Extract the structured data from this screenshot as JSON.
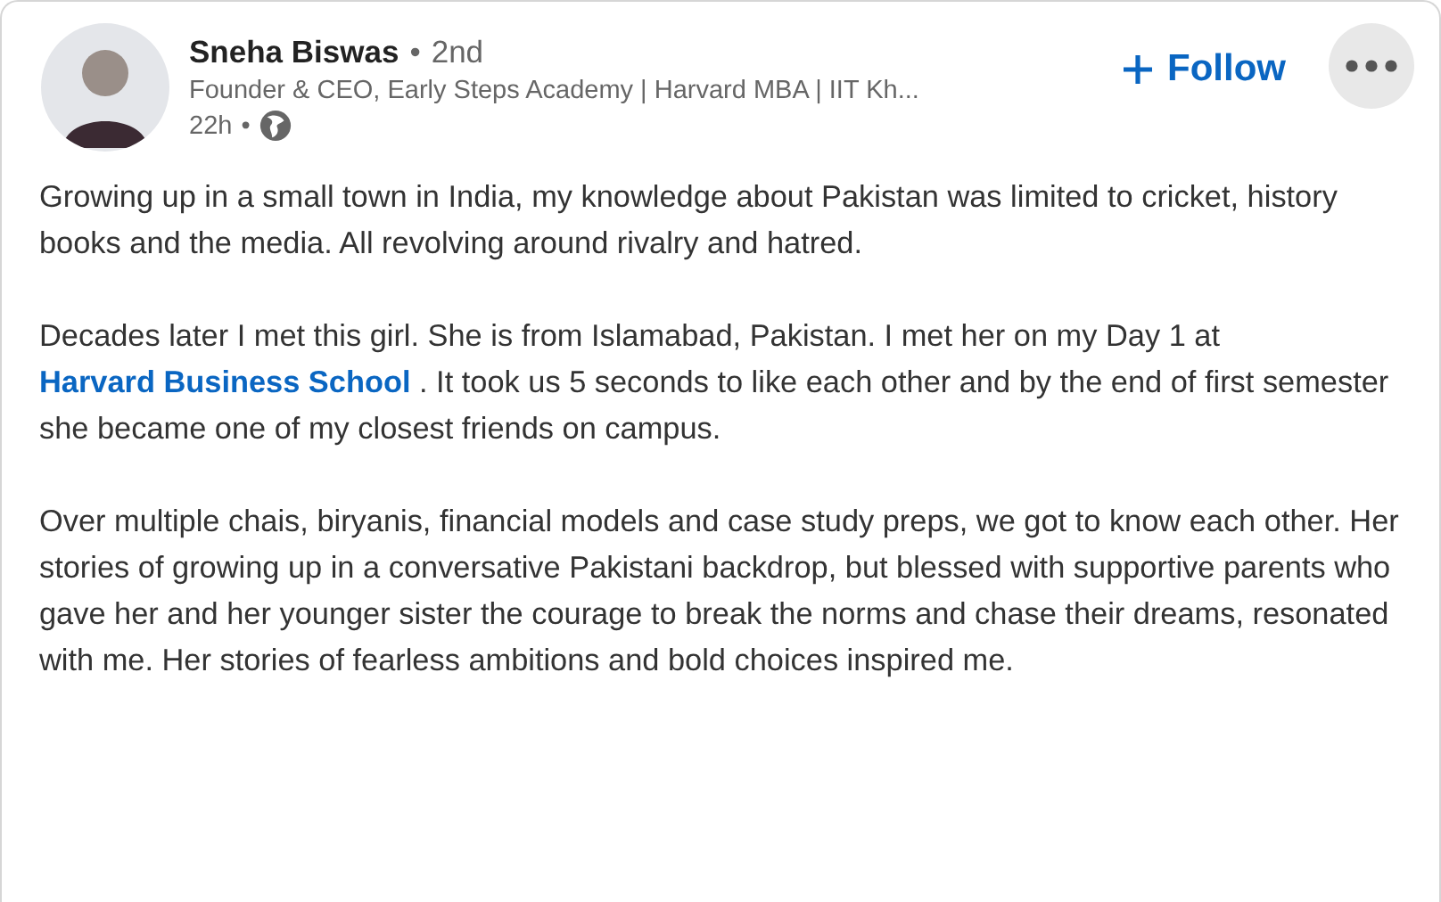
{
  "author": {
    "name": "Sneha Biswas",
    "separator": "•",
    "degree": "2nd",
    "headline": "Founder & CEO, Early Steps Academy | Harvard MBA | IIT Kh...",
    "time": "22h",
    "time_separator": "•"
  },
  "follow_button": {
    "label": "Follow"
  },
  "paragraphs": [
    {
      "parts": [
        {
          "kind": "text",
          "text": "Growing up in a small town in India, my knowledge about Pakistan was limited to cricket, history books and the media. All revolving around rivalry and hatred."
        }
      ]
    },
    {
      "parts": [
        {
          "kind": "text",
          "text": "Decades later I met this girl. She is from Islamabad, Pakistan. I met her on my Day 1 at "
        },
        {
          "kind": "link",
          "text": "Harvard Business School"
        },
        {
          "kind": "text",
          "text": " . It took us 5 seconds to like each other and by the end of first semester she became one of my closest friends on campus."
        }
      ]
    },
    {
      "parts": [
        {
          "kind": "text",
          "text": "Over multiple chais, biryanis, financial models and case study preps, we got to know each other. Her stories of growing up in a conversative Pakistani backdrop, but blessed with supportive parents who gave her and her younger sister the courage to break the norms and chase their dreams, resonated with me. Her stories of fearless ambitions and bold choices inspired me."
        }
      ]
    }
  ]
}
